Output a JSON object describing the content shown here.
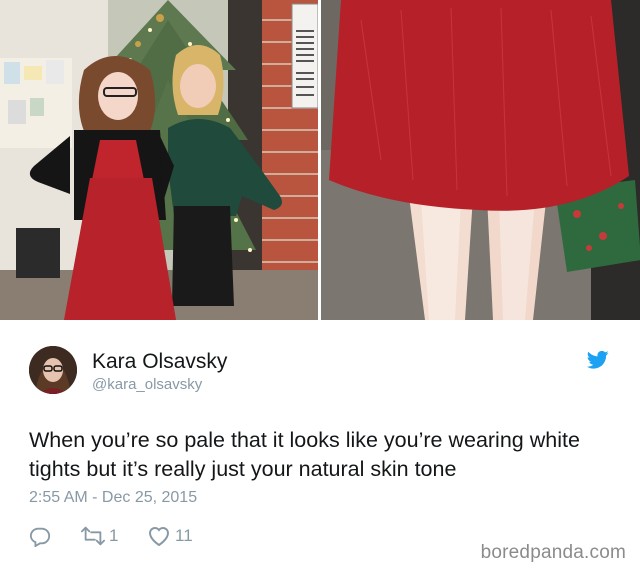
{
  "tweet": {
    "author_name": "Kara Olsavsky",
    "handle": "@kara_olsavsky",
    "text": "When you’re so pale that it looks like you’re wearing white tights but it’s really just your natural skin tone",
    "timestamp": "2:55 AM - Dec 25, 2015",
    "retweet_count": "1",
    "like_count": "11",
    "icons": [
      "reply-icon",
      "retweet-icon",
      "like-icon",
      "twitter-bird-icon"
    ]
  },
  "photos": {
    "left_caption_label": "two-women-by-christmas-tree-photo",
    "right_caption_label": "red-dress-legs-closeup-photo"
  },
  "watermark": "boredpanda.com",
  "colors": {
    "twitter_blue": "#1da1f2",
    "secondary_text": "#8899a6",
    "primary_text": "#14171a",
    "dress_red": "#c0242c"
  }
}
